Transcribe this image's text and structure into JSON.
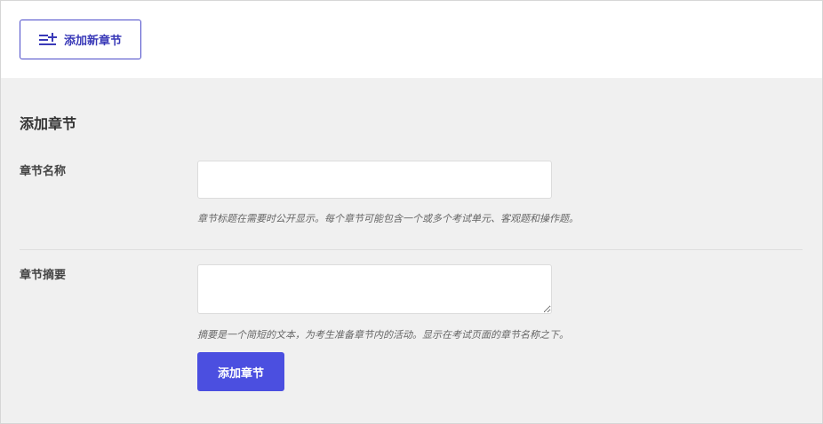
{
  "toolbar": {
    "add_new_label": "添加新章节",
    "add_new_icon": "list-add-icon"
  },
  "form": {
    "title": "添加章节",
    "name_field": {
      "label": "章节名称",
      "value": "",
      "help": "章节标题在需要时公开显示。每个章节可能包含一个或多个考试单元、客观题和操作题。"
    },
    "summary_field": {
      "label": "章节摘要",
      "value": "",
      "help": "摘要是一个简短的文本，为考生准备章节内的活动。显示在考试页面的章节名称之下。"
    },
    "submit_label": "添加章节"
  },
  "colors": {
    "accent": "#4b4fe0",
    "accent_border": "#4a4ac9",
    "panel_bg": "#f0f0f0"
  }
}
